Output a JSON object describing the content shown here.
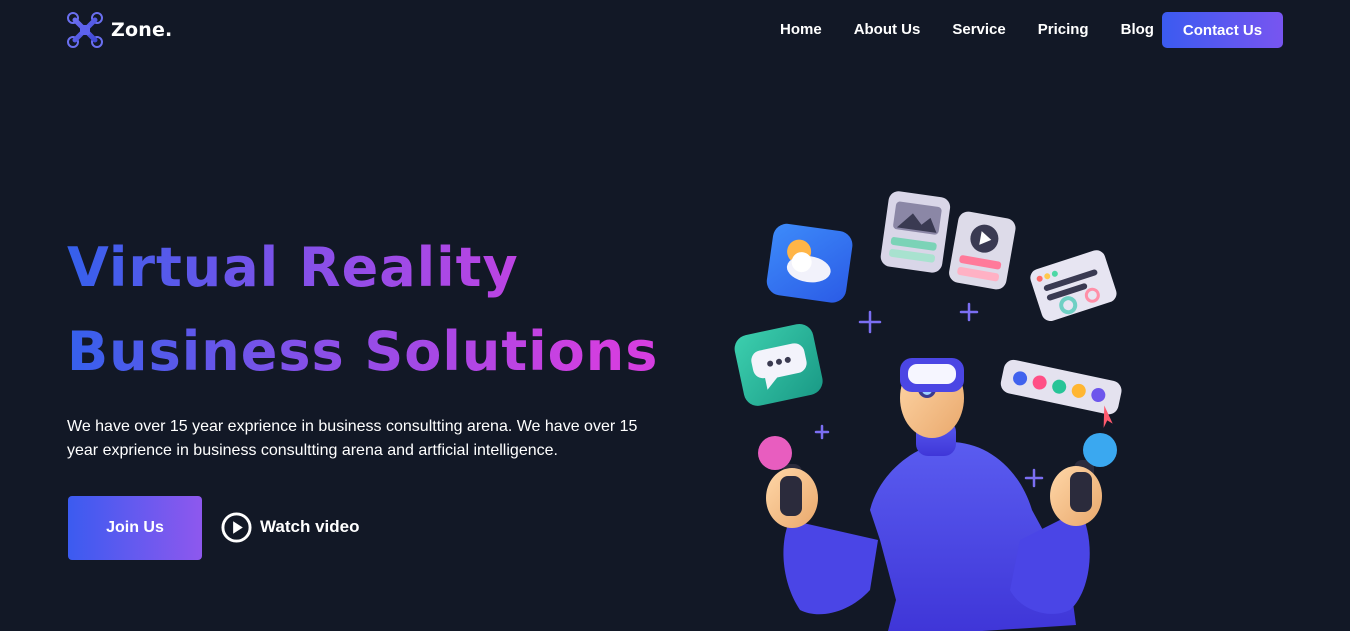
{
  "brand": {
    "name": "Zone.",
    "logo_icon": "drone-logo-icon",
    "accent_start": "#3b5bf0",
    "accent_end": "#8e58ee",
    "background": "#121826"
  },
  "nav": {
    "items": [
      {
        "label": "Home"
      },
      {
        "label": "About Us"
      },
      {
        "label": "Service"
      },
      {
        "label": "Pricing"
      },
      {
        "label": "Blog"
      }
    ],
    "cta_label": "Contact Us"
  },
  "hero": {
    "title_line1": "Virtual Reality",
    "title_line2": "Business Solutions",
    "description": "We have over 15 year exprience in business consultting arena. We have over 15 year exprience in business consultting arena and artficial intelligence.",
    "primary_button": "Join Us",
    "video_label": "Watch video",
    "video_icon": "play-circle-icon",
    "illustration": "vr-user-with-floating-app-icons"
  }
}
